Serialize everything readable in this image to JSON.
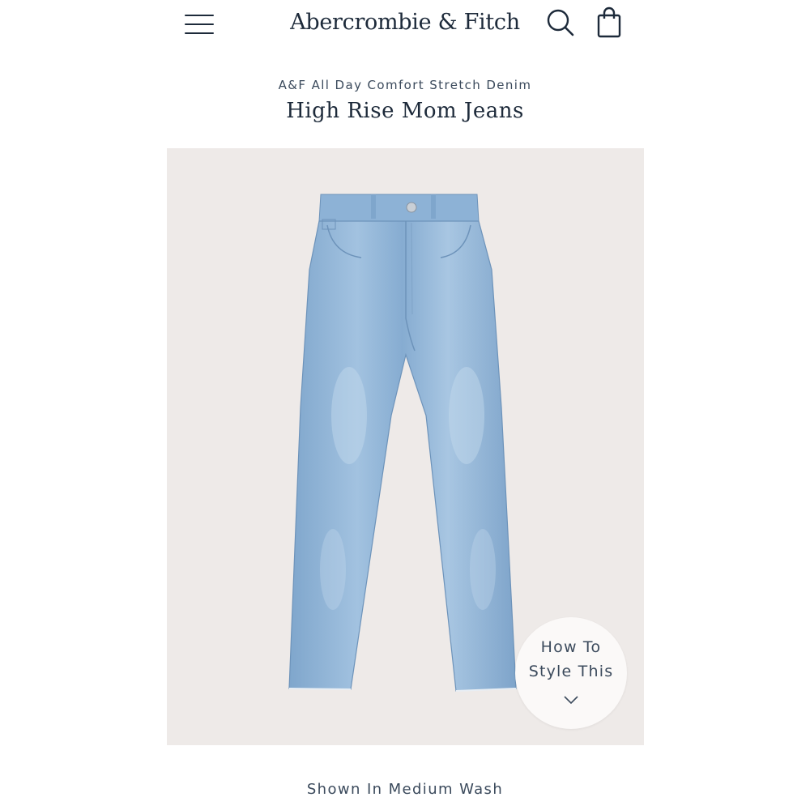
{
  "header": {
    "brand": "Abercrombie & Fitch",
    "icons": {
      "menu": "hamburger-menu-icon",
      "search": "search-icon",
      "bag": "shopping-bag-icon"
    }
  },
  "product": {
    "collection": "A&F All Day Comfort Stretch Denim",
    "title": "High Rise Mom Jeans",
    "image_subject": "jeans-product-image",
    "style_button": {
      "line1": "How To",
      "line2": "Style This",
      "icon": "chevron-down-icon"
    },
    "caption": "Shown In Medium Wash"
  },
  "colors": {
    "text_primary": "#1d2a3a",
    "image_background": "#eeeae8",
    "denim": "#8fb3d3"
  }
}
